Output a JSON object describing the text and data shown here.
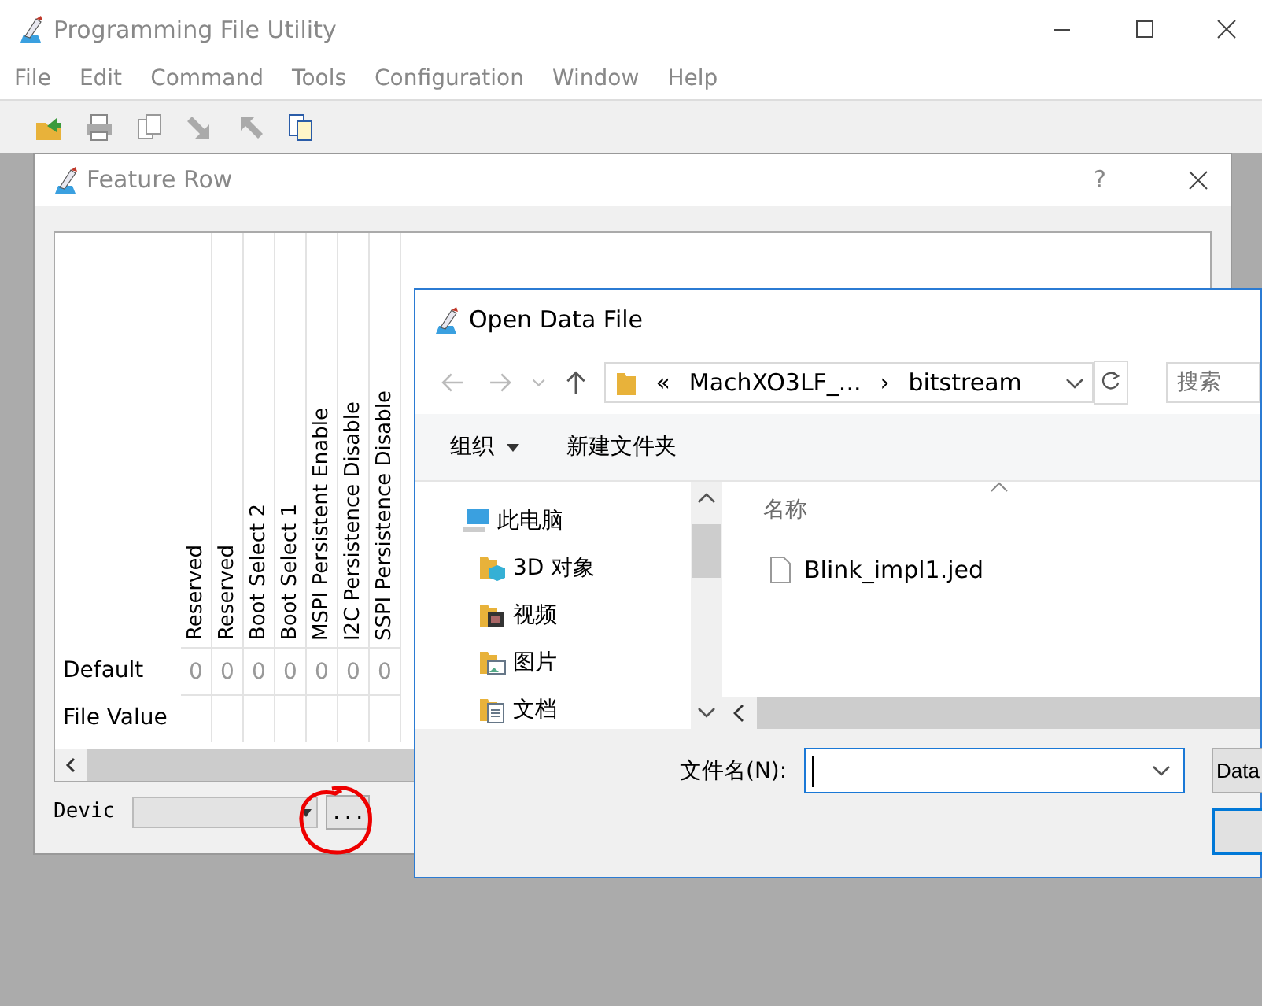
{
  "main_window": {
    "title": "Programming File Utility",
    "menu": [
      "File",
      "Edit",
      "Command",
      "Tools",
      "Configuration",
      "Window",
      "Help"
    ]
  },
  "feature_row": {
    "title": "Feature Row",
    "help": "?",
    "columns": [
      "Reserved",
      "Reserved",
      "Boot Select 2",
      "Boot Select 1",
      "MSPI Persistent Enable",
      "I2C Persistence Disable",
      "SSPI Persistence Disable"
    ],
    "rows": [
      {
        "label": "Default",
        "values": [
          "0",
          "0",
          "0",
          "0",
          "0",
          "0",
          "0"
        ]
      },
      {
        "label": "File Value",
        "values": []
      }
    ],
    "device_label": "Devic",
    "browse_button": "..."
  },
  "open_dialog": {
    "title": "Open Data File",
    "breadcrumb": [
      "«",
      "MachXO3LF_...",
      "›",
      "bitstream"
    ],
    "search_placeholder": "搜索",
    "toolbar": [
      {
        "label": "组织",
        "dropdown": true
      },
      {
        "label": "新建文件夹",
        "dropdown": false
      }
    ],
    "nav_tree": [
      {
        "label": "此电脑",
        "kind": "computer",
        "children": [
          {
            "label": "3D 对象",
            "kind": "cube"
          },
          {
            "label": "视频",
            "kind": "film"
          },
          {
            "label": "图片",
            "kind": "image"
          },
          {
            "label": "文档",
            "kind": "document"
          }
        ]
      }
    ],
    "column_header": "名称",
    "files": [
      "Blink_impl1.jed"
    ],
    "filename_label": "文件名(N):",
    "file_type": "Data"
  }
}
